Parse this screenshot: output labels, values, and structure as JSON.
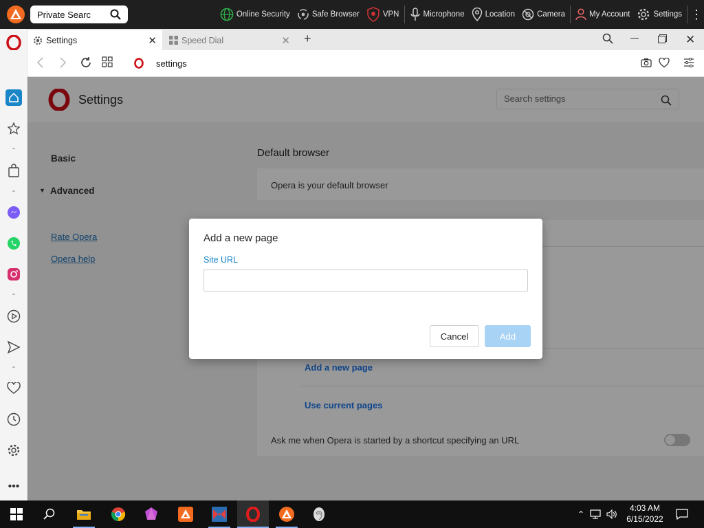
{
  "topbar": {
    "search_value": "Private Searc",
    "items": [
      {
        "label": "Online Security",
        "icon": "globe-icon"
      },
      {
        "label": "Safe Browser",
        "icon": "shield-cycle-icon"
      },
      {
        "label": "VPN",
        "icon": "vpn-shield-icon"
      },
      {
        "label": "Microphone",
        "icon": "microphone-icon"
      },
      {
        "label": "Location",
        "icon": "location-pin-icon"
      },
      {
        "label": "Camera",
        "icon": "camera-blocked-icon"
      },
      {
        "label": "My Account",
        "icon": "user-icon"
      },
      {
        "label": "Settings",
        "icon": "gear-icon"
      }
    ]
  },
  "tabs": [
    {
      "label": "Settings",
      "active": true
    },
    {
      "label": "Speed Dial",
      "active": false
    }
  ],
  "addressbar": {
    "url": "settings"
  },
  "settings_page": {
    "title": "Settings",
    "search_placeholder": "Search settings",
    "nav": {
      "basic": "Basic",
      "advanced": "Advanced",
      "rate": "Rate Opera",
      "help": "Opera help"
    },
    "default_browser": {
      "heading": "Default browser",
      "status": "Opera is your default browser"
    },
    "startup": {
      "add_page": "Add a new page",
      "use_current": "Use current pages",
      "shortcut_label": "Ask me when Opera is started by a shortcut specifying an URL"
    }
  },
  "dialog": {
    "title": "Add a new page",
    "field_label": "Site URL",
    "field_value": "",
    "cancel_label": "Cancel",
    "add_label": "Add"
  },
  "taskbar": {
    "time": "4:03 AM",
    "date": "6/15/2022"
  },
  "colors": {
    "accent": "#1a86c8",
    "opera_red": "#cc0f16",
    "add_button_disabled": "#a9d3f5"
  }
}
